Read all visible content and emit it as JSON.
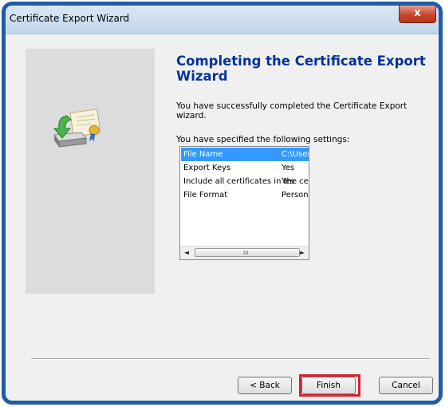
{
  "window": {
    "title": "Certificate Export Wizard",
    "close_label": "x"
  },
  "main": {
    "heading": "Completing the Certificate Export Wizard",
    "description": "You have successfully completed the Certificate Export wizard.",
    "settings_label": "You have specified the following settings:"
  },
  "settings": {
    "rows": [
      {
        "name": "File Name",
        "value": "C:\\User"
      },
      {
        "name": "Export Keys",
        "value": "Yes"
      },
      {
        "name": "Include all certificates in the certification path",
        "value": "Yes"
      },
      {
        "name": "File Format",
        "value": "Persona"
      }
    ],
    "scroll_left": "◄",
    "scroll_right": "►",
    "scroll_grip": "III"
  },
  "buttons": {
    "back": "< Back",
    "finish": "Finish",
    "cancel": "Cancel"
  },
  "colors": {
    "frame": "#1f5da4",
    "heading": "#003399",
    "selection": "#3399ff",
    "finish_highlight": "#d8232a"
  }
}
